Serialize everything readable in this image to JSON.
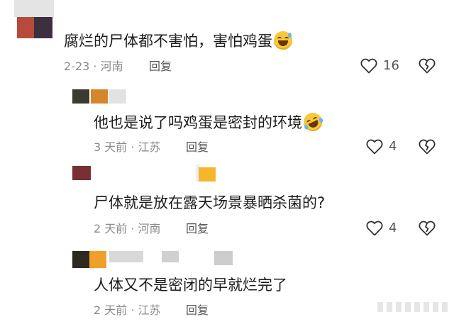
{
  "comments": [
    {
      "text": "腐烂的尸体都不害怕，害怕鸡蛋",
      "emoji": "grinning-sweat-emoji",
      "meta": "2-23 · 河南",
      "reply_label": "回复",
      "likes": "16"
    },
    {
      "text": "他也是说了吗鸡蛋是密封的环境",
      "emoji": "rolling-laughing-emoji",
      "meta": "3 天前 · 江苏",
      "reply_label": "回复",
      "likes": "4"
    },
    {
      "text": "尸体就是放在露天场景暴晒杀菌的?",
      "meta": "2 天前 · 河南",
      "reply_label": "回复",
      "likes": "4"
    },
    {
      "text": "人体又不是密闭的早就烂完了",
      "meta": "2 天前 · 江苏",
      "reply_label": "回复"
    }
  ],
  "colors": {
    "text": "#1c1c1c",
    "meta": "#8a8a8a",
    "emoji": "#f7c83a"
  }
}
